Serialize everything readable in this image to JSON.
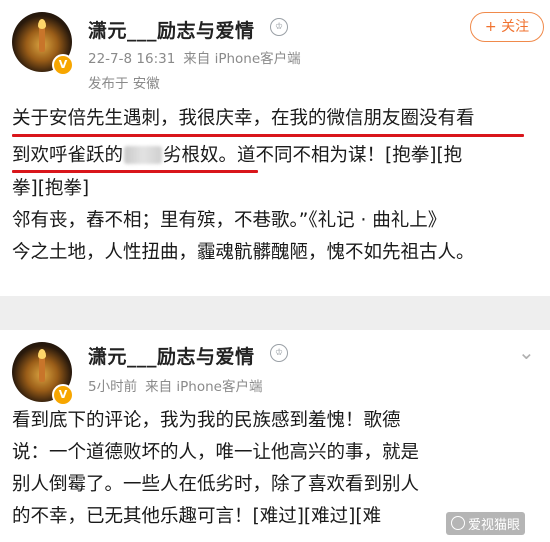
{
  "post1": {
    "author": "潇元___励志与爱情",
    "timestamp": "22-7-8 16:31",
    "source": "来自 iPhone客户端",
    "location": "发布于 安徽",
    "follow_label": "+ 关注",
    "lines": [
      "关于安倍先生遇刺，我很庆幸，在我的微信朋友圈没有看",
      "劣根奴。道不同不相为谋！[抱拳][抱",
      "拳][抱拳]",
      "邻有丧，舂不相；里有殡，不巷歌。”《礼记 · 曲礼上》",
      "今之土地，人性扭曲，霾魂骯髒醜陋，愧不如先祖古人。"
    ],
    "line2_prefix": "到欢呼雀跃的"
  },
  "post2": {
    "author": "潇元___励志与爱情",
    "timestamp": "5小时前",
    "source": "来自 iPhone客户端",
    "lines": [
      "看到底下的评论，我为我的民族感到羞愧！歌德",
      "说：一个道德败坏的人，唯一让他高兴的事，就是",
      "别人倒霉了。一些人在低劣时，除了喜欢看到别人",
      "的不幸，已无其他乐趣可言！[难过][难过][难"
    ]
  },
  "watermark": "爱视猫眼",
  "icons": {
    "verified": "verified-v-badge",
    "level": "member-level-icon",
    "more": "more-options-icon"
  },
  "colors": {
    "underline": "#d9161b",
    "follow": "#f0722f",
    "meta_text": "#8a8a8a",
    "divider": "#eeeeee"
  }
}
